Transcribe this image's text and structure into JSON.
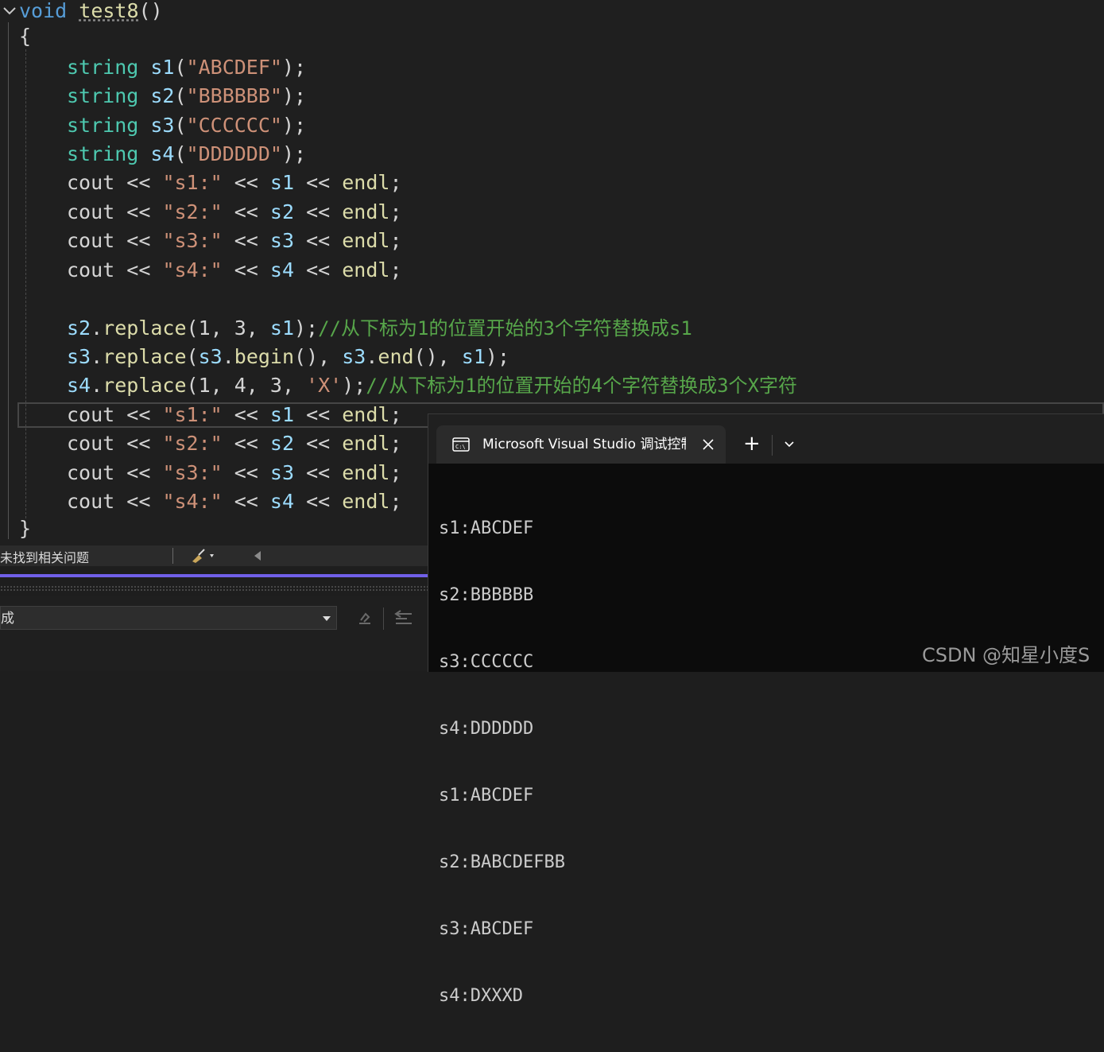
{
  "code": {
    "sig_keyword": "void",
    "sig_name": "test8",
    "sig_parens": "()",
    "open_brace": "{",
    "close_brace": "}",
    "decls": [
      {
        "type": "string",
        "var": "s1",
        "open": "(",
        "lit": "\"ABCDEF\"",
        "close": ");"
      },
      {
        "type": "string",
        "var": "s2",
        "open": "(",
        "lit": "\"BBBBBB\"",
        "close": ");"
      },
      {
        "type": "string",
        "var": "s3",
        "open": "(",
        "lit": "\"CCCCCC\"",
        "close": ");"
      },
      {
        "type": "string",
        "var": "s4",
        "open": "(",
        "lit": "\"DDDDDD\"",
        "close": ");"
      }
    ],
    "couts1": [
      {
        "cout": "cout",
        "op": " << ",
        "lit": "\"s1:\"",
        "op2": " << ",
        "var": "s1",
        "op3": " << ",
        "endl": "endl",
        "semi": ";"
      },
      {
        "cout": "cout",
        "op": " << ",
        "lit": "\"s2:\"",
        "op2": " << ",
        "var": "s2",
        "op3": " << ",
        "endl": "endl",
        "semi": ";"
      },
      {
        "cout": "cout",
        "op": " << ",
        "lit": "\"s3:\"",
        "op2": " << ",
        "var": "s3",
        "op3": " << ",
        "endl": "endl",
        "semi": ";"
      },
      {
        "cout": "cout",
        "op": " << ",
        "lit": "\"s4:\"",
        "op2": " << ",
        "var": "s4",
        "op3": " << ",
        "endl": "endl",
        "semi": ";"
      }
    ],
    "replace1": {
      "var": "s2",
      "dot": ".",
      "fn": "replace",
      "args": "(1, 3, ",
      "arg_var": "s1",
      "end": ");",
      "comment": "//从下标为1的位置开始的3个字符替换成s1"
    },
    "replace2": {
      "var": "s3",
      "dot": ".",
      "fn": "replace",
      "p1": "(",
      "a_var": "s3",
      "a_dot": ".",
      "a_fn": "begin",
      "a_p": "(), ",
      "b_var": "s3",
      "b_dot": ".",
      "b_fn": "end",
      "b_p": "(), ",
      "c_var": "s1",
      "end": ");"
    },
    "replace3": {
      "var": "s4",
      "dot": ".",
      "fn": "replace",
      "args": "(1, 4, 3, ",
      "lit": "'X'",
      "end": ");",
      "comment": "//从下标为1的位置开始的4个字符替换成3个X字符"
    },
    "couts2": [
      {
        "cout": "cout",
        "op": " << ",
        "lit": "\"s1:\"",
        "op2": " << ",
        "var": "s1",
        "op3": " << ",
        "endl": "endl",
        "semi": ";"
      },
      {
        "cout": "cout",
        "op": " << ",
        "lit": "\"s2:\"",
        "op2": " << ",
        "var": "s2",
        "op3": " << ",
        "endl": "endl",
        "semi": ";"
      },
      {
        "cout": "cout",
        "op": " << ",
        "lit": "\"s3:\"",
        "op2": " << ",
        "var": "s3",
        "op3": " << ",
        "endl": "endl",
        "semi": ";"
      },
      {
        "cout": "cout",
        "op": " << ",
        "lit": "\"s4:\"",
        "op2": " << ",
        "var": "s4",
        "op3": " << ",
        "endl": "endl",
        "semi": ";"
      }
    ]
  },
  "status": {
    "issues_text": "未找到相关问题"
  },
  "output_panel": {
    "dropdown_value": "成"
  },
  "terminal": {
    "tab_title": "Microsoft Visual Studio 调试控制台",
    "add_tab_glyph": "+",
    "output_lines": [
      "s1:ABCDEF",
      "s2:BBBBBB",
      "s3:CCCCCC",
      "s4:DDDDDD",
      "s1:ABCDEF",
      "s2:BABCDEFBB",
      "s3:ABCDEF",
      "s4:DXXXD"
    ]
  },
  "watermark": "CSDN @知星小度S",
  "colors": {
    "editor_bg": "#1f1f1f",
    "keyword": "#569cd6",
    "type": "#4ec9b0",
    "variable": "#9cdcfe",
    "string": "#ce9178",
    "function": "#dcdcaa",
    "comment": "#57a64a",
    "accent": "#7160e8",
    "terminal_bg": "#0c0c0c"
  },
  "icons": [
    "collapse-chevron-icon",
    "brush-icon",
    "scroll-left-icon",
    "terminal-app-icon",
    "close-icon",
    "dropdown-chevron-icon"
  ]
}
